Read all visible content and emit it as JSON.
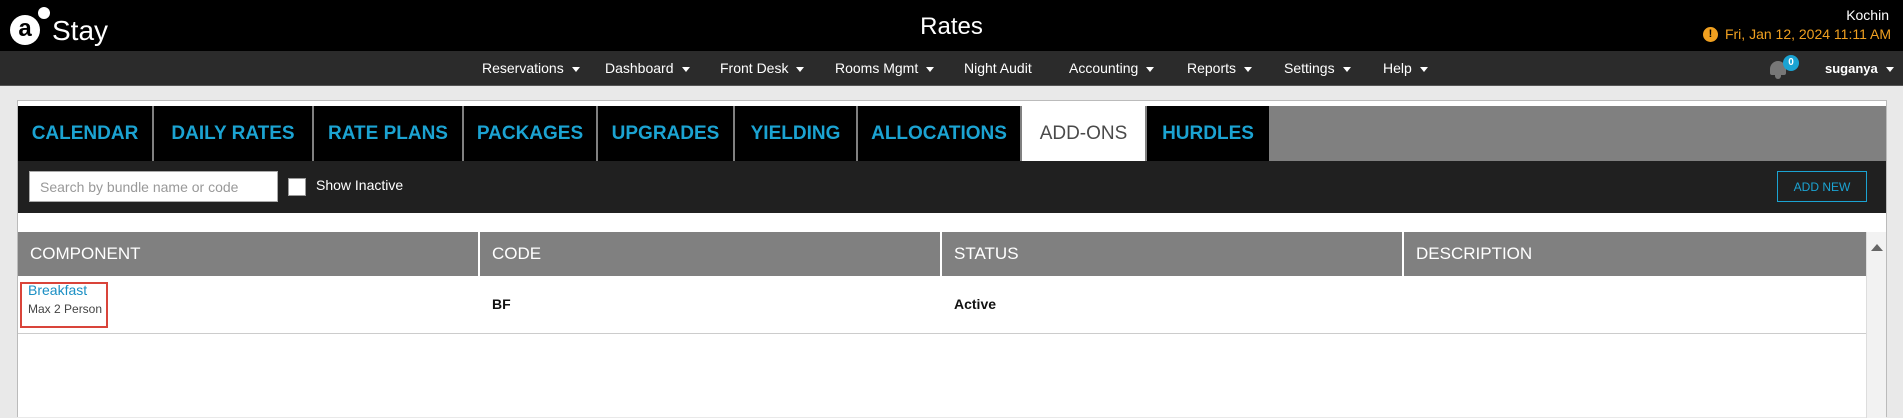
{
  "app": {
    "logo_letter": "a",
    "logo_text": "Stay",
    "page_title": "Rates",
    "location": "Kochin",
    "datetime": "Fri, Jan 12, 2024 11:11 AM",
    "accent_color": "#1ba3d2",
    "warning_color": "#f0a020"
  },
  "nav": {
    "items": [
      {
        "label": "Reservations",
        "has_dropdown": true
      },
      {
        "label": "Dashboard",
        "has_dropdown": true
      },
      {
        "label": "Front Desk",
        "has_dropdown": true
      },
      {
        "label": "Rooms Mgmt",
        "has_dropdown": true
      },
      {
        "label": "Night Audit",
        "has_dropdown": false
      },
      {
        "label": "Accounting",
        "has_dropdown": true
      },
      {
        "label": "Reports",
        "has_dropdown": true
      },
      {
        "label": "Settings",
        "has_dropdown": true
      },
      {
        "label": "Help",
        "has_dropdown": true
      }
    ],
    "notifications_count": "0",
    "username": "suganya"
  },
  "tabs": {
    "items": [
      {
        "label": "CALENDAR"
      },
      {
        "label": "DAILY RATES"
      },
      {
        "label": "RATE PLANS"
      },
      {
        "label": "PACKAGES"
      },
      {
        "label": "UPGRADES"
      },
      {
        "label": "YIELDING"
      },
      {
        "label": "ALLOCATIONS"
      },
      {
        "label": "ADD-ONS"
      },
      {
        "label": "HURDLES"
      }
    ],
    "active": "ADD-ONS"
  },
  "filters": {
    "search_placeholder": "Search by bundle name or code",
    "search_value": "",
    "show_inactive_label": "Show Inactive",
    "show_inactive_checked": false,
    "add_new_label": "ADD NEW"
  },
  "table": {
    "columns": [
      "COMPONENT",
      "CODE",
      "STATUS",
      "DESCRIPTION"
    ],
    "rows": [
      {
        "component": "Breakfast",
        "component_sub": "Max 2 Person",
        "code": "BF",
        "status": "Active",
        "description": ""
      }
    ]
  }
}
